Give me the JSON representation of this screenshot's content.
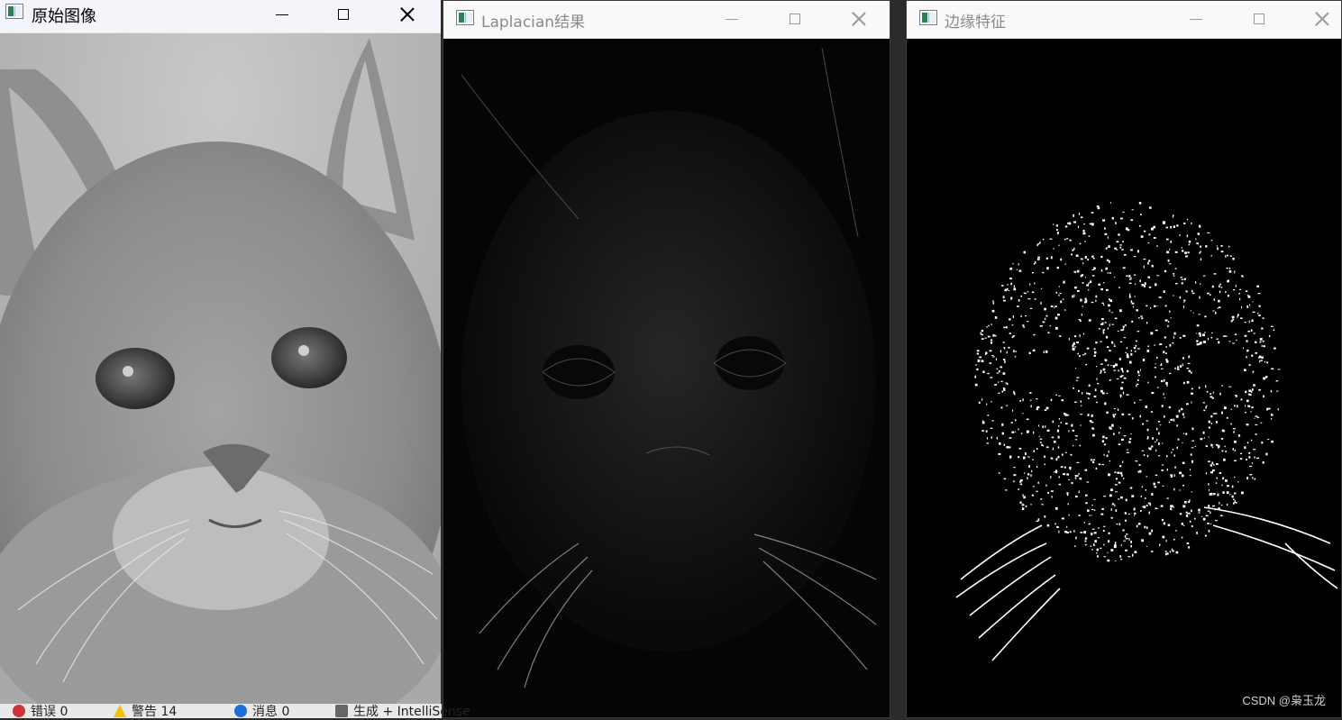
{
  "windows": {
    "original": {
      "title": "原始图像",
      "image_label": "cat-grayscale-photo"
    },
    "laplacian": {
      "title": "Laplacian结果",
      "image_label": "cat-laplacian-edges"
    },
    "edges": {
      "title": "边缘特征",
      "image_label": "cat-binary-edges"
    }
  },
  "taskbar": {
    "items": [
      {
        "icon": "error-icon",
        "label": "错误 0"
      },
      {
        "icon": "warning-icon",
        "label": "警告 14"
      },
      {
        "icon": "info-icon",
        "label": "消息 0"
      },
      {
        "icon": "build-icon",
        "label": "生成 + IntelliSense"
      }
    ]
  },
  "watermark": "CSDN @枭玉龙",
  "colors": {
    "titlebar_active": "#f3f5fa",
    "titlebar_inactive": "#f9f9f9",
    "image_background": "#000000"
  }
}
